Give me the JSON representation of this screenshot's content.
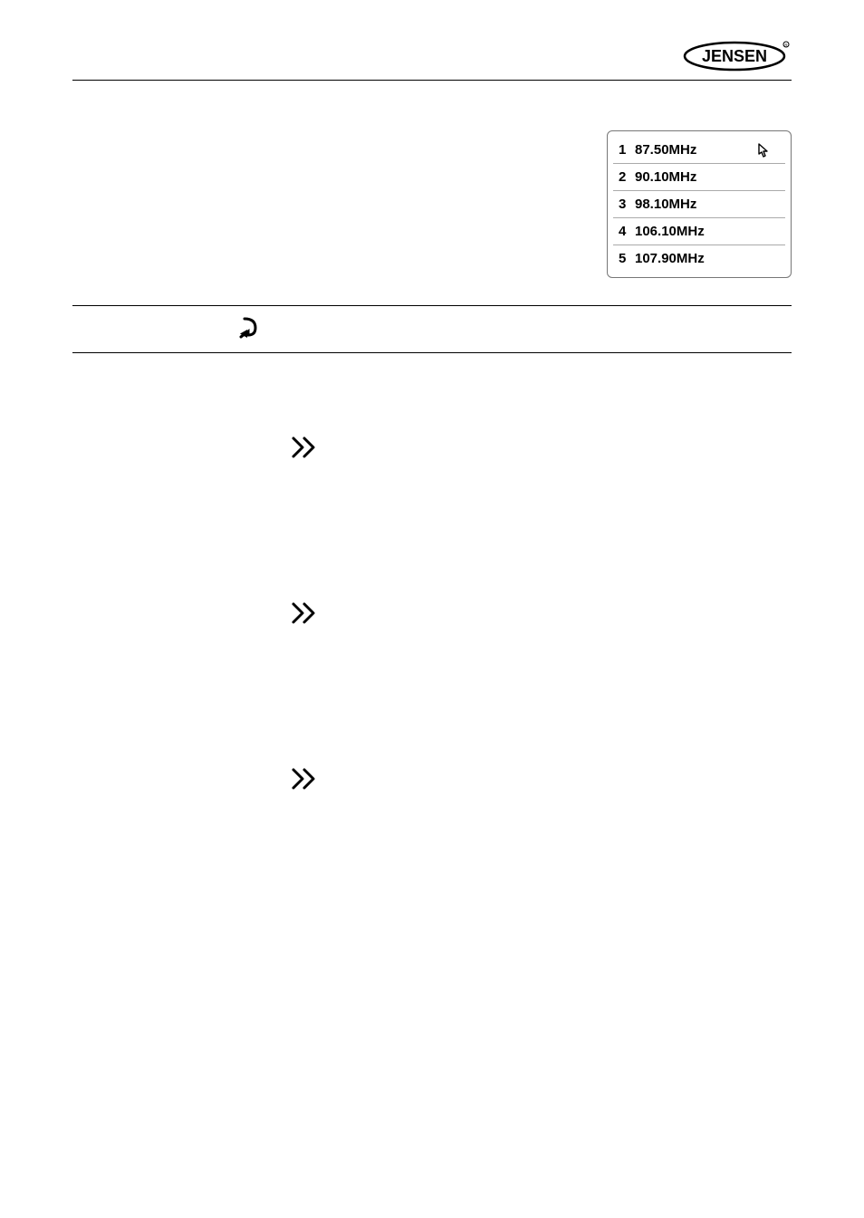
{
  "brand": "JENSEN",
  "presets": [
    {
      "num": "1",
      "freq": "87.50MHz"
    },
    {
      "num": "2",
      "freq": "90.10MHz"
    },
    {
      "num": "3",
      "freq": "98.10MHz"
    },
    {
      "num": "4",
      "freq": "106.10MHz"
    },
    {
      "num": "5",
      "freq": "107.90MHz"
    }
  ]
}
